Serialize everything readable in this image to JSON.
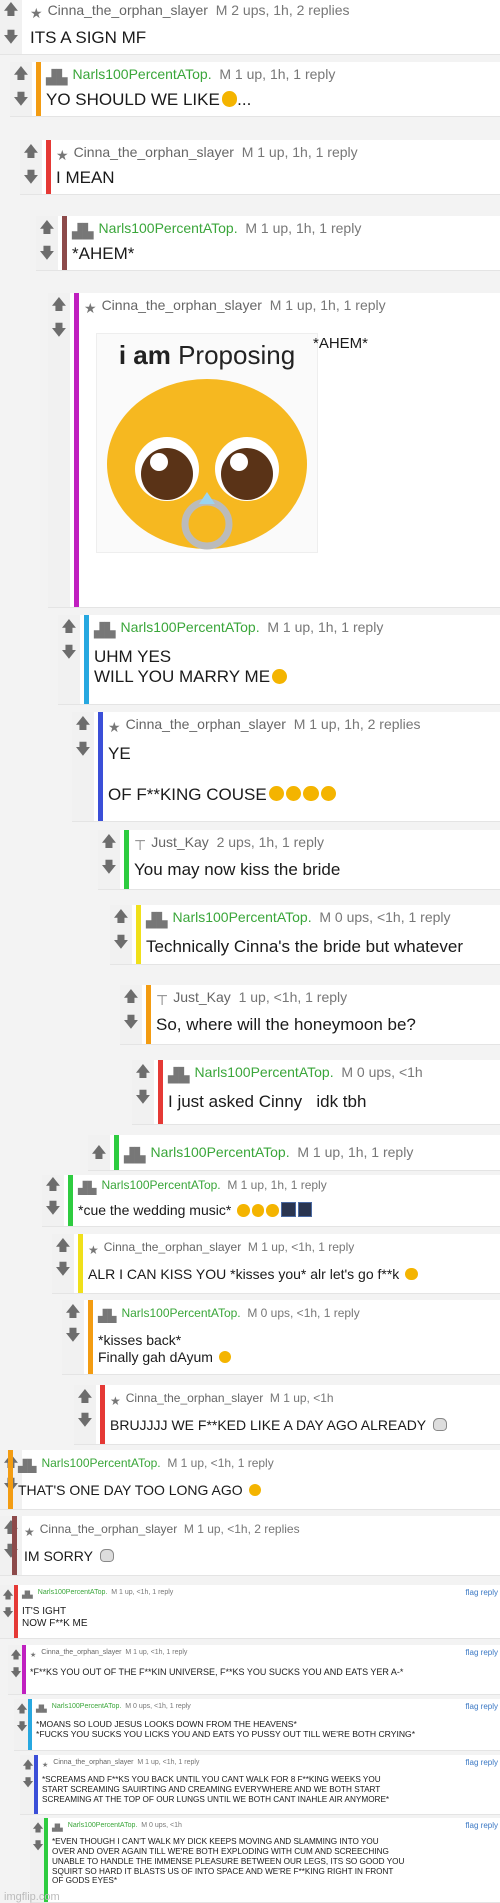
{
  "comments": [
    {
      "user": "Cinna_the_orphan_slayer",
      "meta": "M   2 ups, 1h, 2 replies",
      "body": "ITS A SIGN MF"
    },
    {
      "user": "Narls100PercentATop.",
      "meta": "M   1 up, 1h, 1 reply",
      "body": "YO SHOULD WE LIKE"
    },
    {
      "user": "Cinna_the_orphan_slayer",
      "meta": "M   1 up, 1h, 1 reply",
      "body": "I MEAN"
    },
    {
      "user": "Narls100PercentATop.",
      "meta": "M   1 up, 1h, 1 reply",
      "body": "*AHEM*"
    },
    {
      "user": "Cinna_the_orphan_slayer",
      "meta": "M   1 up, 1h, 1 reply",
      "body": "*AHEM*",
      "meme_text_1": "i am",
      "meme_text_2": "Proposing"
    },
    {
      "user": "Narls100PercentATop.",
      "meta": "M   1 up, 1h, 1 reply",
      "body": "UHM YES\nWILL YOU MARRY ME"
    },
    {
      "user": "Cinna_the_orphan_slayer",
      "meta": "M   1 up, 1h, 2 replies",
      "body": "YE\n\nOF F**KING COUSE"
    },
    {
      "user": "Just_Kay",
      "meta": "2 ups, 1h, 1 reply",
      "body": "You may now kiss the bride"
    },
    {
      "user": "Narls100PercentATop.",
      "meta": "M   0 ups, <1h, 1 reply",
      "body": "Technically Cinna's the bride but whatever"
    },
    {
      "user": "Just_Kay",
      "meta": "1 up, <1h, 1 reply",
      "body": "So, where will the honeymoon be?"
    },
    {
      "user": "Narls100PercentATop.",
      "meta": "M   0 ups, <1h",
      "body": "I just asked Cinny   idk tbh"
    },
    {
      "user": "Narls100PercentATop.",
      "meta": "M   1 up, 1h, 1 reply",
      "body": ""
    },
    {
      "user": "Narls100PercentATop.",
      "meta": "M   1 up, 1h, 1 reply",
      "body": "*cue the wedding music*"
    },
    {
      "user": "Cinna_the_orphan_slayer",
      "meta": "M   1 up, <1h, 1 reply",
      "body": "ALR I CAN KISS YOU *kisses you* alr let's go f**k"
    },
    {
      "user": "Narls100PercentATop.",
      "meta": "M   0 ups, <1h, 1 reply",
      "body": "*kisses back*\nFinally gah dAyum"
    },
    {
      "user": "Cinna_the_orphan_slayer",
      "meta": "M   1 up, <1h",
      "body": "BRUJJJJ WE F**KED LIKE A DAY AGO ALREADY"
    },
    {
      "user": "Narls100PercentATop.",
      "meta": "M   1 up, <1h, 1 reply",
      "body": "THAT'S ONE DAY TOO LONG AGO"
    },
    {
      "user": "Cinna_the_orphan_slayer",
      "meta": "M   1 up, <1h, 2 replies",
      "body": "IM SORRY"
    },
    {
      "user": "Narls100PercentATop.",
      "meta": "M   1 up, <1h, 1 reply",
      "body": "IT'S IGHT\nNOW F**K ME"
    },
    {
      "user": "Cinna_the_orphan_slayer",
      "meta": "M   1 up, <1h, 1 reply",
      "body": "*F**KS YOU OUT OF THE F**KIN UNIVERSE, F**KS YOU SUCKS YOU AND EATS YER A-*"
    },
    {
      "user": "Narls100PercentATop.",
      "meta": "M   0 ups, <1h, 1 reply",
      "body": "*MOANS SO LOUD JESUS LOOKS DOWN FROM THE HEAVENS*\n*FUCKS YOU SUCKS YOU LICKS YOU AND EATS YO PUSSY OUT TILL WE'RE BOTH CRYING*"
    },
    {
      "user": "Cinna_the_orphan_slayer",
      "meta": "M   1 up, <1h, 1 reply",
      "body": "*SCREAMS AND F**KS YOU BACK UNTIL YOU CANT WALK FOR 8 F**KING WEEKS YOU\nSTART SCREAMING SAUIRTING AND CREAMING EVERYWHERE AND WE BOTH START\nSCREAMING AT THE TOP OF OUR LUNGS UNTIL WE BOTH CANT INAHLE AIR ANYMORE*"
    },
    {
      "user": "Narls100PercentATop.",
      "meta": "M   0 ups, <1h",
      "body": "*EVEN THOUGH I CAN'T WALK MY DICK KEEPS MOVING AND SLAMMING INTO YOU\nOVER AND OVER AGAIN TILL WE'RE BOTH EXPLODING WITH CUM AND SCREECHING\nUNABLE TO HANDLE THE IMMENSE PLEASURE BETWEEN OUR LEGS, ITS SO GOOD YOU\nSQUIRT SO HARD IT BLASTS US OF INTO SPACE AND WE'RE F**KING RIGHT IN FRONT\nOF GODS EYES*"
    }
  ],
  "flag_reply": "flag  reply",
  "watermark": "imgflip.com"
}
